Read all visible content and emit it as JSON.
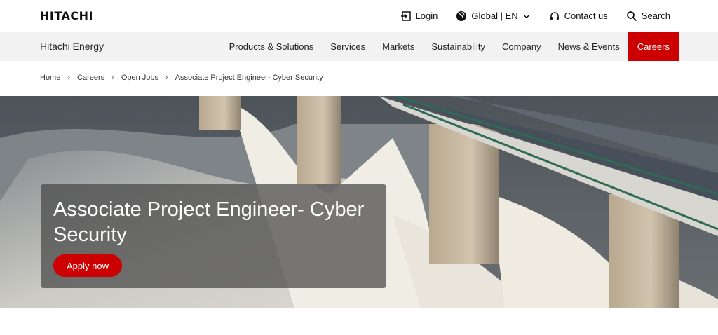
{
  "header": {
    "logo": "HITACHI",
    "links": [
      {
        "label": "Login",
        "icon": "login-icon"
      },
      {
        "label": "Global | EN",
        "icon": "globe-icon"
      },
      {
        "label": "Contact us",
        "icon": "headset-icon"
      },
      {
        "label": "Search",
        "icon": "search-icon"
      }
    ]
  },
  "navbar": {
    "brand": "Hitachi Energy",
    "items": [
      {
        "label": "Products & Solutions"
      },
      {
        "label": "Services"
      },
      {
        "label": "Markets"
      },
      {
        "label": "Sustainability"
      },
      {
        "label": "Company"
      },
      {
        "label": "News & Events"
      },
      {
        "label": "Careers",
        "active": true
      }
    ]
  },
  "breadcrumb": {
    "items": [
      "Home",
      "Careers",
      "Open Jobs"
    ],
    "current": "Associate Project Engineer- Cyber Security"
  },
  "hero": {
    "title": "Associate Project Engineer- Cyber Security",
    "apply_label": "Apply now"
  },
  "colors": {
    "accent": "#cc0000",
    "nav_bg": "#f2f2f2"
  }
}
